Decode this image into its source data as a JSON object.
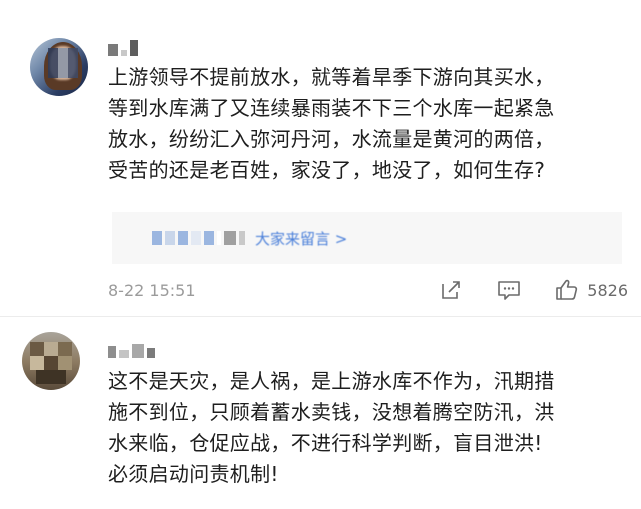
{
  "comments": [
    {
      "text": "上游领导不提前放水，就等着旱季下游向其买水，\n等到水库满了又连续暴雨装不下三个水库一起紧急\n放水，纷纷汇入弥河丹河，水流量是黄河的两倍，\n受苦的还是老百姓，家没了，地没了，如何生存?",
      "quote_text": "大家来留言 >",
      "time": "8-22 15:51",
      "like_count": "5826"
    },
    {
      "text": "这不是天灾，是人祸，是上游水库不作为，汛期措\n施不到位，只顾着蓄水卖钱，没想着腾空防汛，洪\n水来临，仓促应战，不进行科学判断，盲目泄洪!\n必须启动问责机制!"
    }
  ],
  "icons": {
    "share": "share-icon",
    "comment": "comment-icon",
    "like": "thumbs-up-icon"
  },
  "colors": {
    "link": "#4a7fd9",
    "meta": "#9b9b9b",
    "text": "#1e1e1e"
  }
}
